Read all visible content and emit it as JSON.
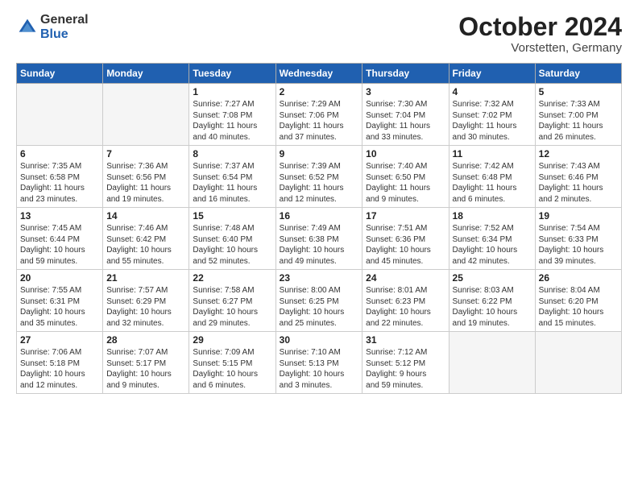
{
  "logo": {
    "general": "General",
    "blue": "Blue"
  },
  "header": {
    "month_year": "October 2024",
    "location": "Vorstetten, Germany"
  },
  "days_of_week": [
    "Sunday",
    "Monday",
    "Tuesday",
    "Wednesday",
    "Thursday",
    "Friday",
    "Saturday"
  ],
  "weeks": [
    [
      {
        "num": "",
        "detail": ""
      },
      {
        "num": "",
        "detail": ""
      },
      {
        "num": "1",
        "detail": "Sunrise: 7:27 AM\nSunset: 7:08 PM\nDaylight: 11 hours\nand 40 minutes."
      },
      {
        "num": "2",
        "detail": "Sunrise: 7:29 AM\nSunset: 7:06 PM\nDaylight: 11 hours\nand 37 minutes."
      },
      {
        "num": "3",
        "detail": "Sunrise: 7:30 AM\nSunset: 7:04 PM\nDaylight: 11 hours\nand 33 minutes."
      },
      {
        "num": "4",
        "detail": "Sunrise: 7:32 AM\nSunset: 7:02 PM\nDaylight: 11 hours\nand 30 minutes."
      },
      {
        "num": "5",
        "detail": "Sunrise: 7:33 AM\nSunset: 7:00 PM\nDaylight: 11 hours\nand 26 minutes."
      }
    ],
    [
      {
        "num": "6",
        "detail": "Sunrise: 7:35 AM\nSunset: 6:58 PM\nDaylight: 11 hours\nand 23 minutes."
      },
      {
        "num": "7",
        "detail": "Sunrise: 7:36 AM\nSunset: 6:56 PM\nDaylight: 11 hours\nand 19 minutes."
      },
      {
        "num": "8",
        "detail": "Sunrise: 7:37 AM\nSunset: 6:54 PM\nDaylight: 11 hours\nand 16 minutes."
      },
      {
        "num": "9",
        "detail": "Sunrise: 7:39 AM\nSunset: 6:52 PM\nDaylight: 11 hours\nand 12 minutes."
      },
      {
        "num": "10",
        "detail": "Sunrise: 7:40 AM\nSunset: 6:50 PM\nDaylight: 11 hours\nand 9 minutes."
      },
      {
        "num": "11",
        "detail": "Sunrise: 7:42 AM\nSunset: 6:48 PM\nDaylight: 11 hours\nand 6 minutes."
      },
      {
        "num": "12",
        "detail": "Sunrise: 7:43 AM\nSunset: 6:46 PM\nDaylight: 11 hours\nand 2 minutes."
      }
    ],
    [
      {
        "num": "13",
        "detail": "Sunrise: 7:45 AM\nSunset: 6:44 PM\nDaylight: 10 hours\nand 59 minutes."
      },
      {
        "num": "14",
        "detail": "Sunrise: 7:46 AM\nSunset: 6:42 PM\nDaylight: 10 hours\nand 55 minutes."
      },
      {
        "num": "15",
        "detail": "Sunrise: 7:48 AM\nSunset: 6:40 PM\nDaylight: 10 hours\nand 52 minutes."
      },
      {
        "num": "16",
        "detail": "Sunrise: 7:49 AM\nSunset: 6:38 PM\nDaylight: 10 hours\nand 49 minutes."
      },
      {
        "num": "17",
        "detail": "Sunrise: 7:51 AM\nSunset: 6:36 PM\nDaylight: 10 hours\nand 45 minutes."
      },
      {
        "num": "18",
        "detail": "Sunrise: 7:52 AM\nSunset: 6:34 PM\nDaylight: 10 hours\nand 42 minutes."
      },
      {
        "num": "19",
        "detail": "Sunrise: 7:54 AM\nSunset: 6:33 PM\nDaylight: 10 hours\nand 39 minutes."
      }
    ],
    [
      {
        "num": "20",
        "detail": "Sunrise: 7:55 AM\nSunset: 6:31 PM\nDaylight: 10 hours\nand 35 minutes."
      },
      {
        "num": "21",
        "detail": "Sunrise: 7:57 AM\nSunset: 6:29 PM\nDaylight: 10 hours\nand 32 minutes."
      },
      {
        "num": "22",
        "detail": "Sunrise: 7:58 AM\nSunset: 6:27 PM\nDaylight: 10 hours\nand 29 minutes."
      },
      {
        "num": "23",
        "detail": "Sunrise: 8:00 AM\nSunset: 6:25 PM\nDaylight: 10 hours\nand 25 minutes."
      },
      {
        "num": "24",
        "detail": "Sunrise: 8:01 AM\nSunset: 6:23 PM\nDaylight: 10 hours\nand 22 minutes."
      },
      {
        "num": "25",
        "detail": "Sunrise: 8:03 AM\nSunset: 6:22 PM\nDaylight: 10 hours\nand 19 minutes."
      },
      {
        "num": "26",
        "detail": "Sunrise: 8:04 AM\nSunset: 6:20 PM\nDaylight: 10 hours\nand 15 minutes."
      }
    ],
    [
      {
        "num": "27",
        "detail": "Sunrise: 7:06 AM\nSunset: 5:18 PM\nDaylight: 10 hours\nand 12 minutes."
      },
      {
        "num": "28",
        "detail": "Sunrise: 7:07 AM\nSunset: 5:17 PM\nDaylight: 10 hours\nand 9 minutes."
      },
      {
        "num": "29",
        "detail": "Sunrise: 7:09 AM\nSunset: 5:15 PM\nDaylight: 10 hours\nand 6 minutes."
      },
      {
        "num": "30",
        "detail": "Sunrise: 7:10 AM\nSunset: 5:13 PM\nDaylight: 10 hours\nand 3 minutes."
      },
      {
        "num": "31",
        "detail": "Sunrise: 7:12 AM\nSunset: 5:12 PM\nDaylight: 9 hours\nand 59 minutes."
      },
      {
        "num": "",
        "detail": ""
      },
      {
        "num": "",
        "detail": ""
      }
    ]
  ]
}
